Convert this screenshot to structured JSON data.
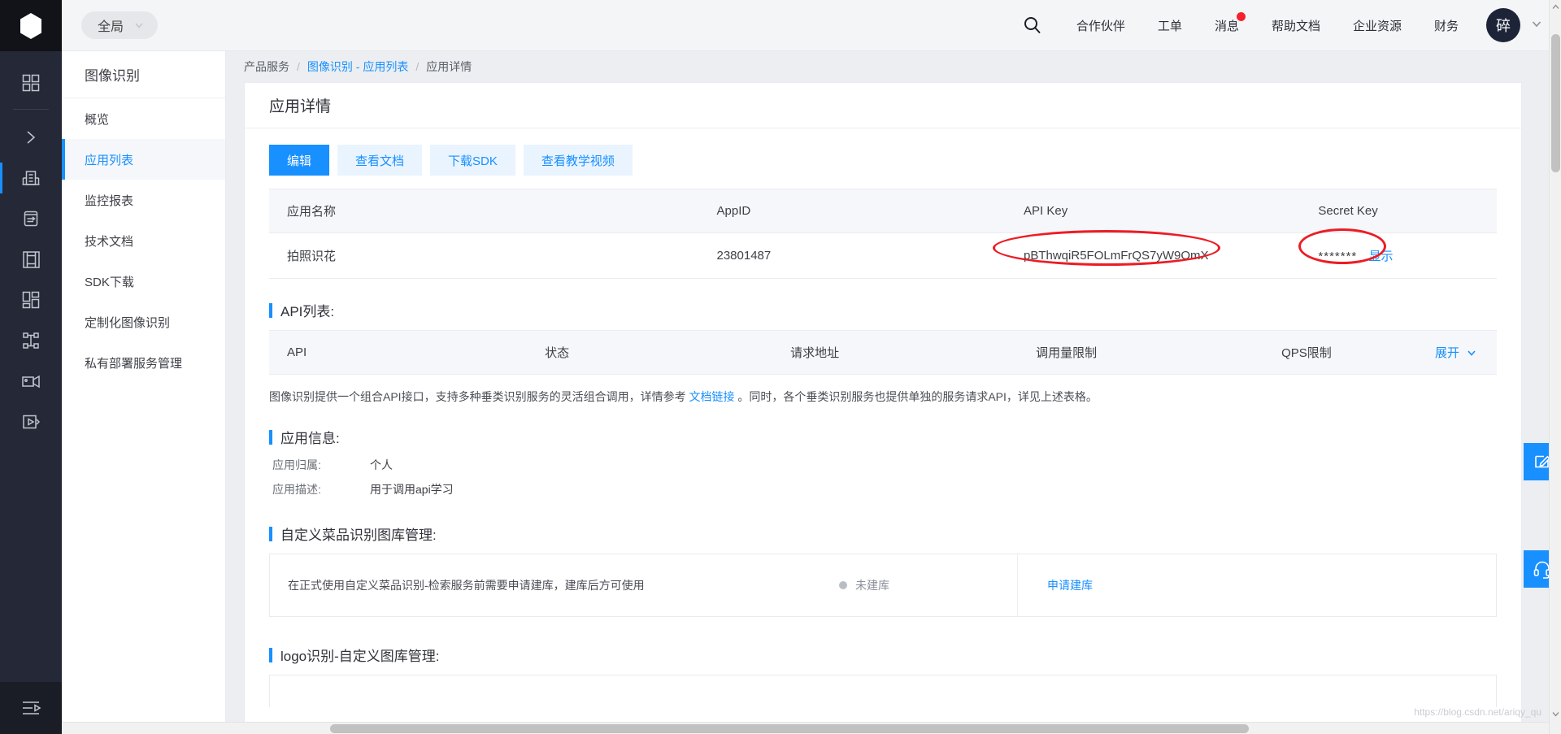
{
  "rail": {
    "logo_icon": "cube-logo-icon",
    "items": [
      {
        "name": "grid-apps-icon",
        "selected": false
      },
      {
        "name": "chevron-right-icon",
        "selected": false
      },
      {
        "name": "enterprise-building-icon",
        "selected": true
      },
      {
        "name": "database-icon",
        "selected": false
      },
      {
        "name": "image-recognition-icon",
        "selected": false
      },
      {
        "name": "dashboard-blocks-icon",
        "selected": false
      },
      {
        "name": "nodes-network-icon",
        "selected": false
      },
      {
        "name": "video-camera-icon",
        "selected": false
      },
      {
        "name": "media-play-icon",
        "selected": false
      }
    ],
    "bottom_icon": "collapse-menu-icon"
  },
  "header": {
    "scope_label": "全局",
    "scope_caret_icon": "chevron-down-icon",
    "search_icon": "search-icon",
    "nav": [
      {
        "label": "合作伙伴",
        "badge": false
      },
      {
        "label": "工单",
        "badge": false
      },
      {
        "label": "消息",
        "badge": true
      },
      {
        "label": "帮助文档",
        "badge": false
      },
      {
        "label": "企业资源",
        "badge": false
      },
      {
        "label": "财务",
        "badge": false
      }
    ],
    "avatar_text": "碎",
    "avatar_caret_icon": "chevron-down-icon"
  },
  "sidebar": {
    "title": "图像识别",
    "items": [
      {
        "label": "概览",
        "selected": false
      },
      {
        "label": "应用列表",
        "selected": true
      },
      {
        "label": "监控报表",
        "selected": false
      },
      {
        "label": "技术文档",
        "selected": false
      },
      {
        "label": "SDK下载",
        "selected": false
      },
      {
        "label": "定制化图像识别",
        "selected": false
      },
      {
        "label": "私有部署服务管理",
        "selected": false
      }
    ]
  },
  "breadcrumb": {
    "root": "产品服务",
    "sep": "/",
    "link": "图像识别 - 应用列表",
    "current": "应用详情"
  },
  "panel": {
    "title": "应用详情",
    "buttons": [
      {
        "label": "编辑",
        "primary": true
      },
      {
        "label": "查看文档",
        "primary": false
      },
      {
        "label": "下载SDK",
        "primary": false
      },
      {
        "label": "查看教学视频",
        "primary": false
      }
    ]
  },
  "app_table": {
    "columns": [
      "应用名称",
      "AppID",
      "API Key",
      "Secret Key"
    ],
    "row": {
      "app_name": "拍照识花",
      "app_id": "23801487",
      "api_key": "pBThwqiR5FOLmFrQS7yW9OmX",
      "secret_masked": "*******",
      "secret_show_label": "显示"
    }
  },
  "api_section": {
    "title": "API列表:",
    "columns": [
      "API",
      "状态",
      "请求地址",
      "调用量限制",
      "QPS限制"
    ],
    "expand_label": "展开",
    "expand_icon": "chevron-down-icon",
    "note_prefix": "图像识别提供一个组合API接口，支持多种垂类识别服务的灵活组合调用，详情参考 ",
    "note_link": "文档链接",
    "note_suffix": " 。同时，各个垂类识别服务也提供单独的服务请求API，详见上述表格。"
  },
  "app_info": {
    "title": "应用信息:",
    "rows": [
      {
        "label": "应用归属:",
        "value": "个人"
      },
      {
        "label": "应用描述:",
        "value": "用于调用api学习"
      }
    ]
  },
  "dish_section": {
    "title": "自定义菜品识别图库管理:",
    "text": "在正式使用自定义菜品识别-检索服务前需要申请建库，建库后方可使用",
    "status": "未建库",
    "action": "申请建库"
  },
  "logo_section": {
    "title": "logo识别-自定义图库管理:"
  },
  "fabs": [
    {
      "name": "feedback-edit-fab",
      "icon": "edit-square-icon"
    },
    {
      "name": "customer-service-fab",
      "icon": "headset-icon"
    }
  ],
  "watermark": "https://blog.csdn.net/ariqy_qu",
  "colors": {
    "accent": "#1890ff",
    "annotation": "#ed1c24",
    "rail_bg": "#252836",
    "page_bg": "#eceef1"
  }
}
